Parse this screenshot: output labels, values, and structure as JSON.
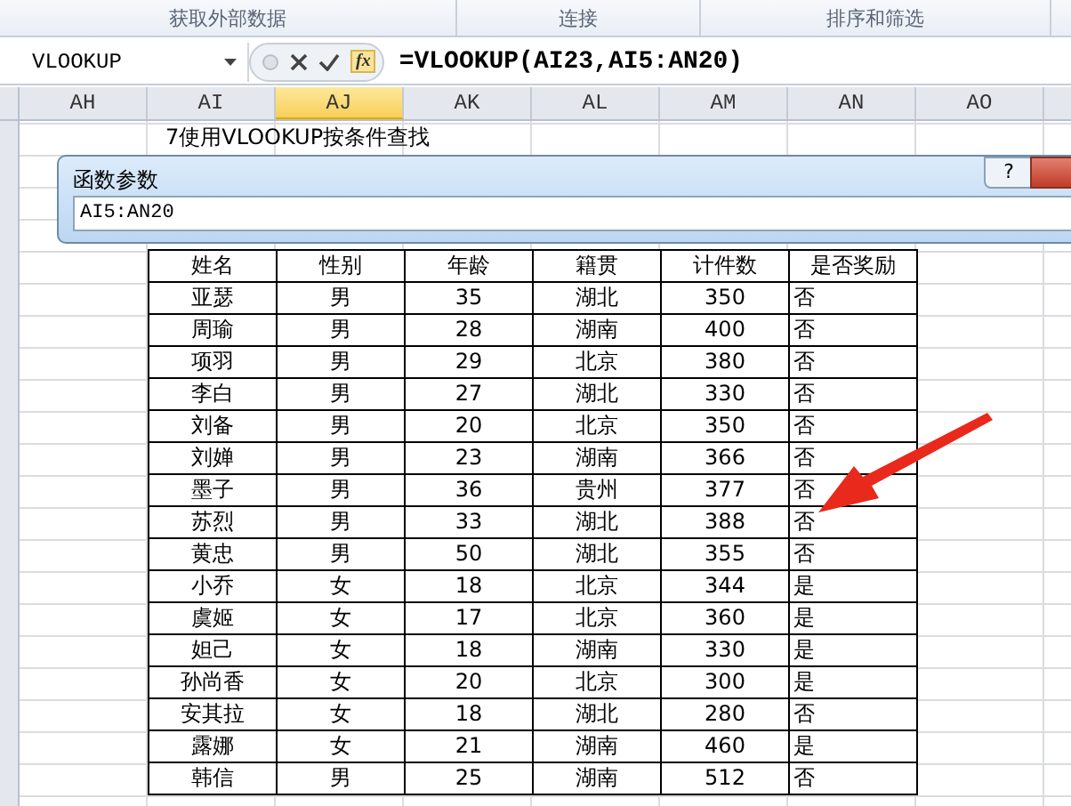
{
  "ribbon_groups": [
    "获取外部数据",
    "连接",
    "排序和筛选"
  ],
  "formula_bar": {
    "name_box": "VLOOKUP",
    "function_button": "fx",
    "formula": "=VLOOKUP(AI23,AI5:AN20)"
  },
  "column_headers": [
    {
      "label": "AH",
      "selected": false
    },
    {
      "label": "AI",
      "selected": false
    },
    {
      "label": "AJ",
      "selected": true
    },
    {
      "label": "AK",
      "selected": false
    },
    {
      "label": "AL",
      "selected": false
    },
    {
      "label": "AM",
      "selected": false
    },
    {
      "label": "AN",
      "selected": false
    },
    {
      "label": "AO",
      "selected": false
    }
  ],
  "sheet_title": "7使用VLOOKUP按条件查找",
  "dialog": {
    "title": "函数参数",
    "help_button": "?",
    "range_field": "AI5:AN20"
  },
  "table": {
    "columns": [
      "姓名",
      "性别",
      "年龄",
      "籍贯",
      "计件数",
      "是否奖励"
    ],
    "rows": [
      [
        "亚瑟",
        "男",
        "35",
        "湖北",
        "350",
        "否"
      ],
      [
        "周瑜",
        "男",
        "28",
        "湖南",
        "400",
        "否"
      ],
      [
        "项羽",
        "男",
        "29",
        "北京",
        "380",
        "否"
      ],
      [
        "李白",
        "男",
        "27",
        "湖北",
        "330",
        "否"
      ],
      [
        "刘备",
        "男",
        "20",
        "北京",
        "350",
        "否"
      ],
      [
        "刘婵",
        "男",
        "23",
        "湖南",
        "366",
        "否"
      ],
      [
        "墨子",
        "男",
        "36",
        "贵州",
        "377",
        "否"
      ],
      [
        "苏烈",
        "男",
        "33",
        "湖北",
        "388",
        "否"
      ],
      [
        "黄忠",
        "男",
        "50",
        "湖北",
        "355",
        "否"
      ],
      [
        "小乔",
        "女",
        "18",
        "北京",
        "344",
        "是"
      ],
      [
        "虞姬",
        "女",
        "17",
        "北京",
        "360",
        "是"
      ],
      [
        "妲己",
        "女",
        "18",
        "湖南",
        "330",
        "是"
      ],
      [
        "孙尚香",
        "女",
        "20",
        "北京",
        "300",
        "是"
      ],
      [
        "安其拉",
        "女",
        "18",
        "湖北",
        "280",
        "否"
      ],
      [
        "露娜",
        "女",
        "21",
        "湖南",
        "460",
        "是"
      ],
      [
        "韩信",
        "男",
        "25",
        "湖南",
        "512",
        "否"
      ]
    ]
  }
}
